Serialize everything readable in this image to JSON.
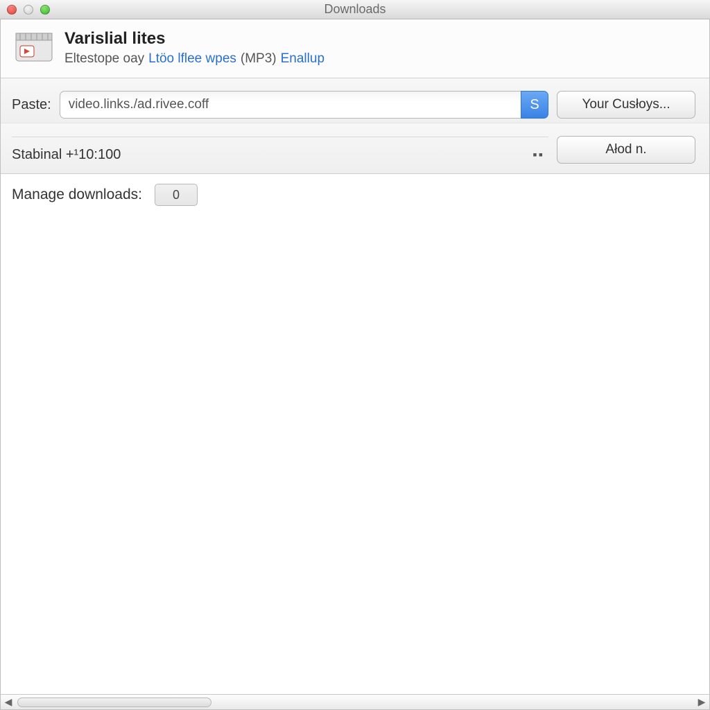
{
  "titlebar": {
    "title": "Downloads"
  },
  "app": {
    "name": "Varislial lites",
    "subtitle_parts": [
      {
        "text": "Eltestope oay",
        "link": false
      },
      {
        "text": "Ltöo lflee wpes",
        "link": true
      },
      {
        "text": "(MP3)",
        "link": false
      },
      {
        "text": "Enallup",
        "link": true
      }
    ]
  },
  "paste": {
    "label": "Paste:",
    "url_value": "video.links./ad.rivee.coff",
    "go_label": "S"
  },
  "buttons": {
    "custom": "Your Cusłoys...",
    "add": "Ałod n."
  },
  "status": {
    "text": "Stabinal +¹10:100",
    "dots": "▪▪"
  },
  "manage": {
    "label": "Manage downloads:",
    "count": "0"
  }
}
